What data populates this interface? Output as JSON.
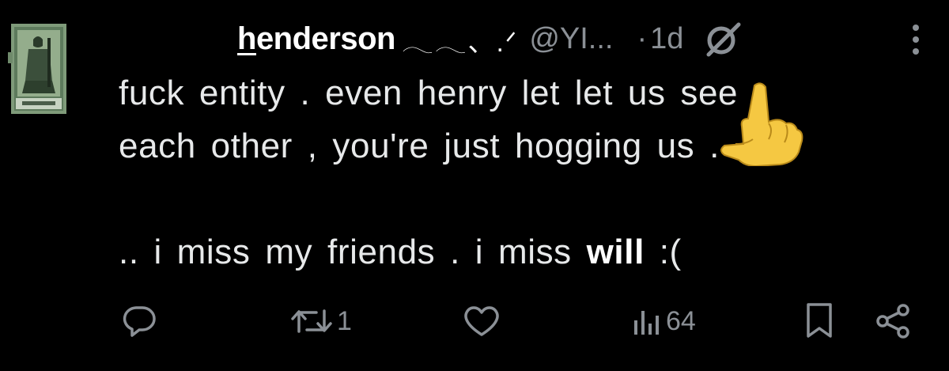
{
  "tweet": {
    "display_name_first": "h",
    "display_name_rest": "enderson",
    "name_decoration": "𓂃𓂃、.ᐟ",
    "handle": "@YI...",
    "separator": "·",
    "time": "1d",
    "body_lines": [
      "fuck entity . even henry let let us see",
      "each other , you're just hogging us ."
    ],
    "body_last_prefix": ".. i miss my friends . i miss ",
    "body_last_bold": "will",
    "body_last_suffix": " :(",
    "hand_emoji": "👆",
    "icons": {
      "avatar": "avatar-image",
      "grok": "grok-icon",
      "more": "more-vertical-icon"
    }
  },
  "actions": {
    "reply": {
      "icon": "reply-icon",
      "count": ""
    },
    "repost": {
      "icon": "repost-icon",
      "count": "1"
    },
    "like": {
      "icon": "heart-icon",
      "count": ""
    },
    "views": {
      "icon": "views-icon",
      "count": "64"
    },
    "bookmark": {
      "icon": "bookmark-icon"
    },
    "share": {
      "icon": "share-icon"
    }
  },
  "colors": {
    "background": "#000000",
    "text": "#e7e9ea",
    "muted": "#8b9096",
    "hand": "#f5c842"
  }
}
